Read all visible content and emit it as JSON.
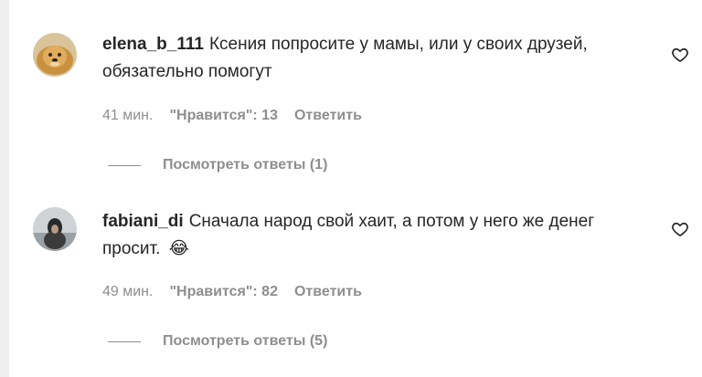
{
  "comments": [
    {
      "username": "elena_b_111",
      "text": "Ксения попросите у мамы, или у своих друзей, обязательно помогут",
      "emoji": "",
      "time": "41 мин.",
      "likes": "\"Нравится\": 13",
      "reply_label": "Ответить",
      "view_replies": "Посмотреть ответы (1)"
    },
    {
      "username": "fabiani_di",
      "text": "Сначала народ свой хаит, а потом у него же денег просит.",
      "emoji": "😂",
      "time": "49 мин.",
      "likes": "\"Нравится\": 82",
      "reply_label": "Ответить",
      "view_replies": "Посмотреть ответы (5)"
    }
  ],
  "colors": {
    "text": "#262626",
    "muted": "#8e8e8e",
    "rail": "#efefef"
  },
  "icons": {
    "like": "heart-outline-icon"
  }
}
